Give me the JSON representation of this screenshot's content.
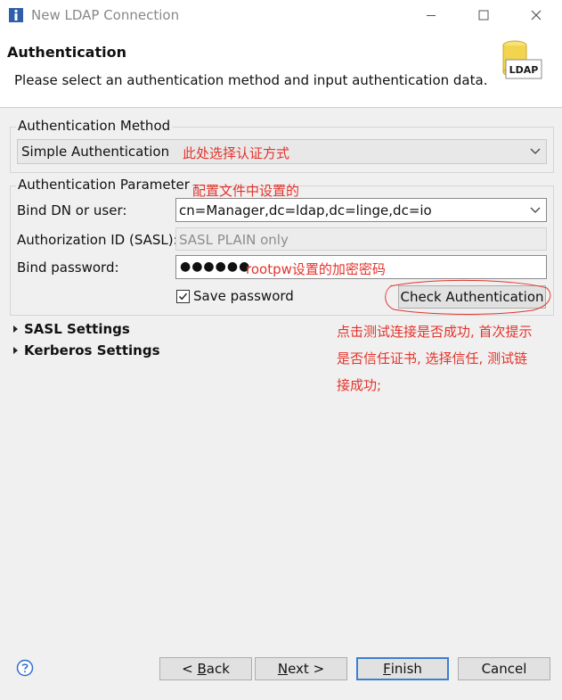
{
  "window": {
    "title": "New LDAP Connection",
    "controls": {
      "minimize": "minimize",
      "maximize": "maximize",
      "close": "close"
    }
  },
  "banner": {
    "title": "Authentication",
    "description": "Please select an authentication method and input authentication data.",
    "icon_text": "LDAP"
  },
  "auth_method": {
    "legend": "Authentication Method",
    "selected": "Simple Authentication",
    "note": "此处选择认证方式"
  },
  "auth_param": {
    "legend": "Authentication Parameter",
    "legend_note": "配置文件中设置的",
    "bind_dn_label": "Bind DN or user:",
    "bind_dn_value": "cn=Manager,dc=ldap,dc=linge,dc=io",
    "authz_label": "Authorization ID (SASL):",
    "authz_placeholder": "SASL PLAIN only",
    "password_label": "Bind password:",
    "password_mask": "●●●●●●",
    "password_note": "rootpw设置的加密密码",
    "save_password_label": "Save password",
    "save_password_checked": true,
    "check_button": "Check Authentication"
  },
  "sections": {
    "sasl": "SASL Settings",
    "kerberos": "Kerberos Settings"
  },
  "annotation": {
    "line1": "点击测试连接是否成功, 首次提示",
    "line2": "是否信任证书, 选择信任, 测试链",
    "line3": "接成功;"
  },
  "footer": {
    "back_prefix": "< ",
    "back_mnemonic": "B",
    "back_rest": "ack",
    "next_mnemonic": "N",
    "next_rest": "ext >",
    "finish_mnemonic": "F",
    "finish_rest": "inish",
    "cancel": "Cancel"
  },
  "colors": {
    "annotation": "#e3332b",
    "default_button_border": "#3c7fd1",
    "panel_bg": "#f0f0f0"
  }
}
